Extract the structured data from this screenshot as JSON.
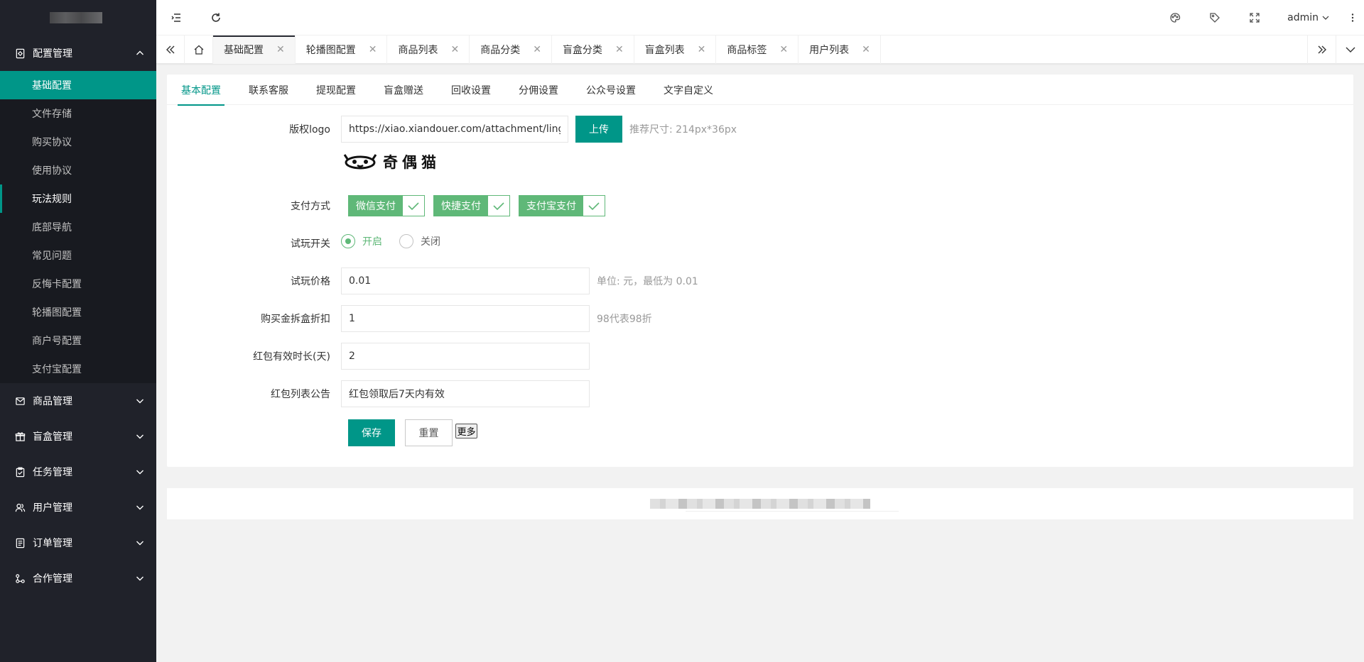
{
  "sidebar": {
    "groups": [
      {
        "label": "配置管理",
        "icon": "settings-doc-icon",
        "expanded": true,
        "items": [
          {
            "label": "基础配置"
          },
          {
            "label": "文件存储"
          },
          {
            "label": "购买协议"
          },
          {
            "label": "使用协议"
          },
          {
            "label": "玩法规则"
          },
          {
            "label": "底部导航"
          },
          {
            "label": "常见问题"
          },
          {
            "label": "反悔卡配置"
          },
          {
            "label": "轮播图配置"
          },
          {
            "label": "商户号配置"
          },
          {
            "label": "支付宝配置"
          }
        ]
      },
      {
        "label": "商品管理",
        "icon": "mail-icon"
      },
      {
        "label": "盲盒管理",
        "icon": "gift-icon"
      },
      {
        "label": "任务管理",
        "icon": "clipboard-check-icon"
      },
      {
        "label": "用户管理",
        "icon": "users-icon"
      },
      {
        "label": "订单管理",
        "icon": "order-list-icon"
      },
      {
        "label": "合作管理",
        "icon": "link-icon"
      }
    ]
  },
  "header": {
    "user": "admin"
  },
  "tabs": [
    {
      "label": "基础配置"
    },
    {
      "label": "轮播图配置"
    },
    {
      "label": "商品列表"
    },
    {
      "label": "商品分类"
    },
    {
      "label": "盲盒分类"
    },
    {
      "label": "盲盒列表"
    },
    {
      "label": "商品标签"
    },
    {
      "label": "用户列表"
    }
  ],
  "subtabs": [
    {
      "label": "基本配置"
    },
    {
      "label": "联系客服"
    },
    {
      "label": "提现配置"
    },
    {
      "label": "盲盒赠送"
    },
    {
      "label": "回收设置"
    },
    {
      "label": "分佣设置"
    },
    {
      "label": "公众号设置"
    },
    {
      "label": "文字自定义"
    }
  ],
  "form": {
    "logo": {
      "label": "版权logo",
      "value": "https://xiao.xiandouer.com/attachment/lingchi_blin",
      "upload": "上传",
      "hint": "推荐尺寸: 214px*36px",
      "logo_text": "奇偶猫"
    },
    "payment": {
      "label": "支付方式",
      "options": [
        {
          "label": "微信支付"
        },
        {
          "label": "快捷支付"
        },
        {
          "label": "支付宝支付"
        }
      ]
    },
    "trial_switch": {
      "label": "试玩开关",
      "on": "开启",
      "off": "关闭"
    },
    "trial_price": {
      "label": "试玩价格",
      "value": "0.01",
      "hint": "单位: 元，最低为 0.01"
    },
    "discount": {
      "label": "购买金拆盒折扣",
      "value": "1",
      "hint": "98代表98折"
    },
    "redpack_days": {
      "label": "红包有效时长(天)",
      "value": "2"
    },
    "redpack_notice": {
      "label": "红包列表公告",
      "value": "红包领取后7天内有效"
    },
    "save": "保存",
    "reset": "重置",
    "more": "更多"
  },
  "colors": {
    "primary": "#009688",
    "success": "#5fb878",
    "sidebar_bg": "#20222a"
  }
}
